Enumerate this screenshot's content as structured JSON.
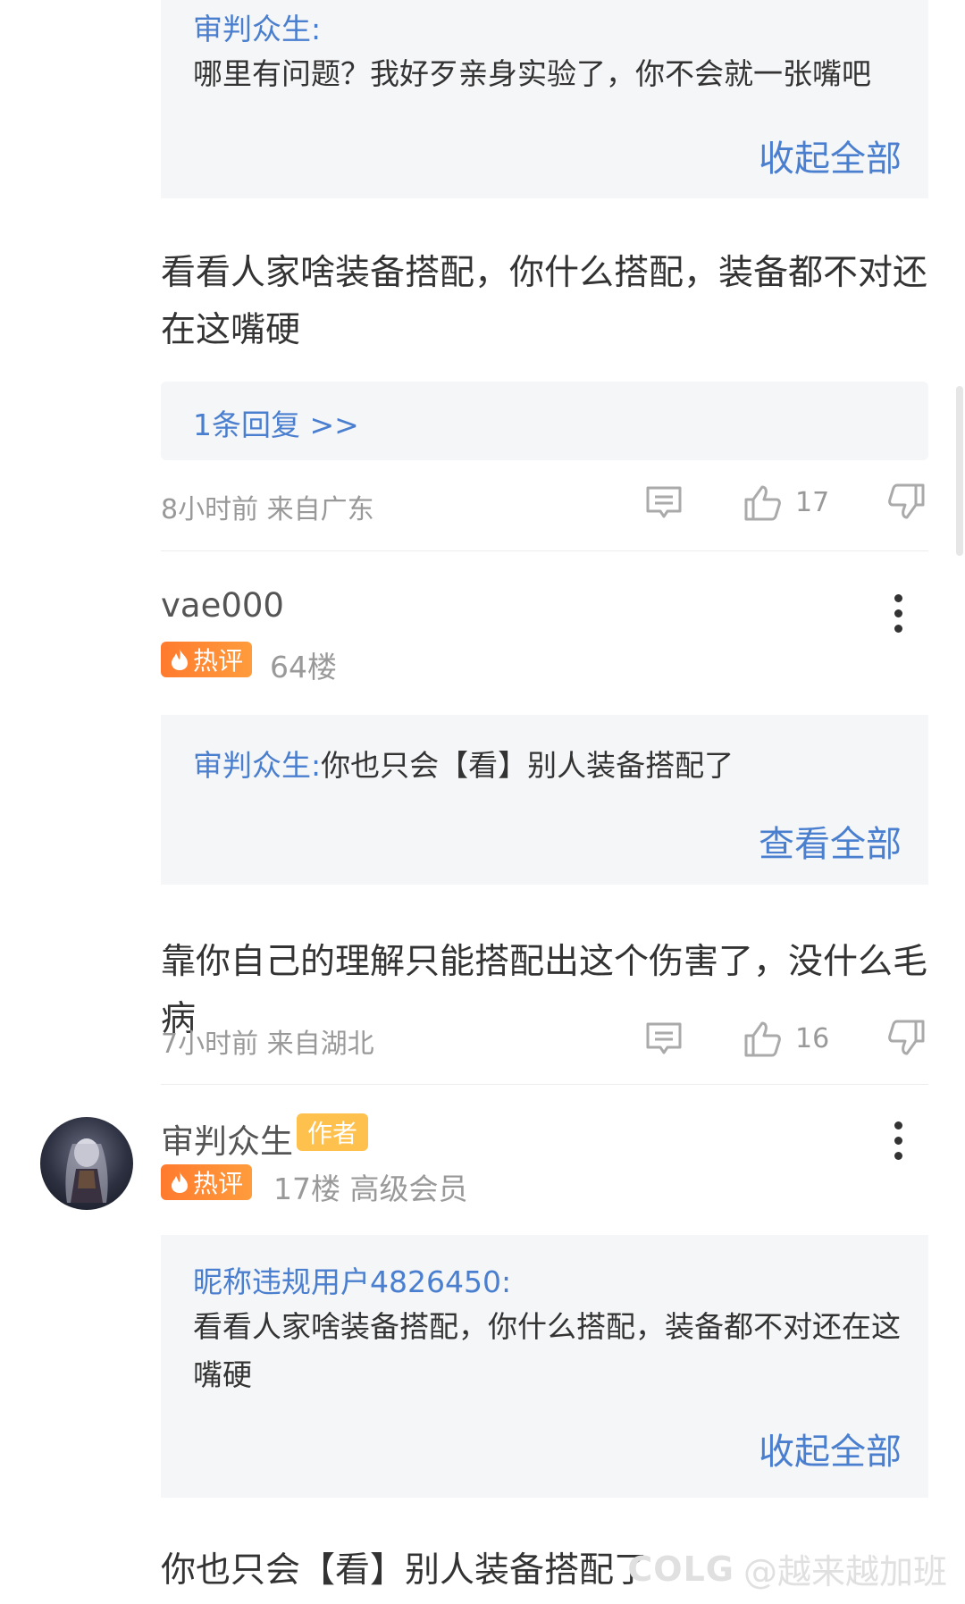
{
  "thread": {
    "quote1": {
      "author": "审判众生:",
      "text": "哪里有问题？我好歹亲身实验了，你不会就一张嘴吧",
      "toggle": "收起全部"
    },
    "comment1": {
      "text": "看看人家啥装备搭配，你什么搭配，装备都不对还在这嘴硬",
      "replies": "1条回复 >>",
      "meta": "8小时前 来自广东",
      "likes": "17"
    },
    "comment2": {
      "username": "vae000",
      "hot_label": "热评",
      "floor": "64楼",
      "quote": {
        "author": "审判众生:",
        "text": "你也只会【看】别人装备搭配了",
        "toggle": "查看全部"
      },
      "text": "靠你自己的理解只能搭配出这个伤害了，没什么毛病",
      "meta": "7小时前 来自湖北",
      "likes": "16"
    },
    "comment3": {
      "username": "审判众生",
      "author_badge": "作者",
      "hot_label": "热评",
      "floor": "17楼 高级会员",
      "quote": {
        "author": "昵称违规用户4826450:",
        "text": "看看人家啥装备搭配，你什么搭配，装备都不对还在这嘴硬",
        "toggle": "收起全部"
      },
      "text": "你也只会【看】别人装备搭配了"
    }
  },
  "watermark": {
    "logo": "COLG",
    "text": "@越来越加班"
  },
  "icons": [
    "comment-icon",
    "thumbs-up-icon",
    "thumbs-down-icon",
    "more-icon",
    "fire-icon"
  ],
  "colors": {
    "link": "#4a7fd0",
    "hot": "#ff7a2e",
    "author": "#ffc14d",
    "quote_bg": "#f5f6f7"
  }
}
